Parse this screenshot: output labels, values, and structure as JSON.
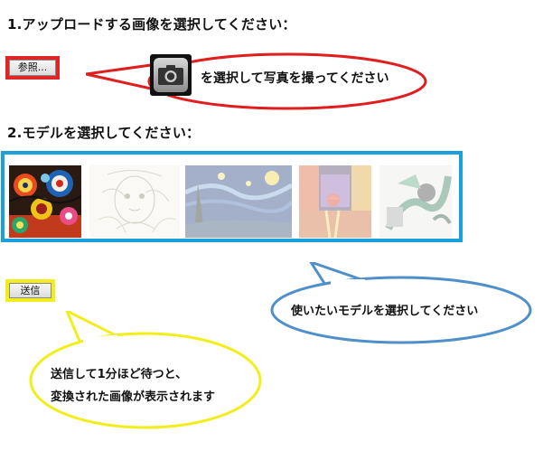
{
  "step1": {
    "heading": "1.アップロードする画像を選択してください：",
    "browse_label": "参照...",
    "camera_hint": "を選択して写真を撮ってください"
  },
  "step2": {
    "heading": "2.モデルを選択してください："
  },
  "models": [
    {
      "name": "colorful-circles-art"
    },
    {
      "name": "sketch-portrait-art"
    },
    {
      "name": "starry-night-art"
    },
    {
      "name": "rainy-street-art"
    },
    {
      "name": "green-abstract-art"
    }
  ],
  "send": {
    "label": "送信"
  },
  "callouts": {
    "model_hint": "使いたいモデルを選択してください",
    "result_line1": "送信して1分ほど待つと、",
    "result_line2": "変換された画像が表示されます"
  },
  "colors": {
    "red_callout": "#e01e1e",
    "blue_callout": "#4f8fca",
    "yellow_callout": "#f2ee1b",
    "models_border": "#1aa1dc"
  }
}
